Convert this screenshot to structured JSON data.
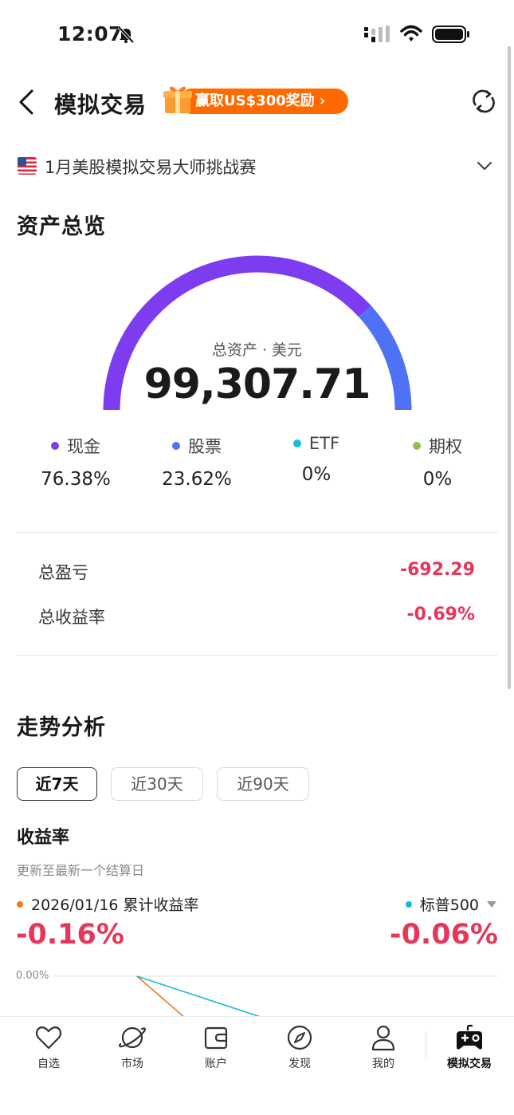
{
  "status_bar": {
    "time": "12:07"
  },
  "header": {
    "title": "模拟交易",
    "promo_label": "赢取US$300奖励 ›"
  },
  "competition": {
    "name": "1月美股模拟交易大师挑战赛"
  },
  "overview": {
    "title": "资产总览",
    "total_assets_label": "总资产 · 美元",
    "total_assets_value": "99,307.71",
    "allocation": [
      {
        "label": "现金",
        "value": "76.38%",
        "color": "#7d3cf0",
        "fraction": 0.7638
      },
      {
        "label": "股票",
        "value": "23.62%",
        "color": "#4f72f5",
        "fraction": 0.2362
      },
      {
        "label": "ETF",
        "value": "0%",
        "color": "#16c0d4",
        "fraction": 0
      },
      {
        "label": "期权",
        "value": "0%",
        "color": "#8cc152",
        "fraction": 0
      }
    ],
    "pl": {
      "total_pl_label": "总盈亏",
      "total_pl_value": "-692.29",
      "total_return_label": "总收益率",
      "total_return_value": "-0.69%"
    }
  },
  "trend": {
    "title": "走势分析",
    "tabs": [
      {
        "label": "近7天",
        "active": true
      },
      {
        "label": "近30天",
        "active": false
      },
      {
        "label": "近90天",
        "active": false
      }
    ],
    "return_title": "收益率",
    "note": "更新至最新一个结算日",
    "legend_left": "2026/01/16 累计收益率",
    "legend_left_color": "#f07a1a",
    "legend_right": "标普500",
    "legend_right_color": "#16bcd0",
    "left_value": "-0.16%",
    "right_value": "-0.06%",
    "axis_label": "0.00%"
  },
  "bottom_nav": [
    {
      "label": "自选",
      "icon": "heart-icon"
    },
    {
      "label": "市场",
      "icon": "planet-icon"
    },
    {
      "label": "账户",
      "icon": "wallet-icon"
    },
    {
      "label": "发现",
      "icon": "compass-icon"
    },
    {
      "label": "我的",
      "icon": "person-icon"
    },
    {
      "label": "模拟交易",
      "icon": "gamepad-icon",
      "active": true
    }
  ]
}
